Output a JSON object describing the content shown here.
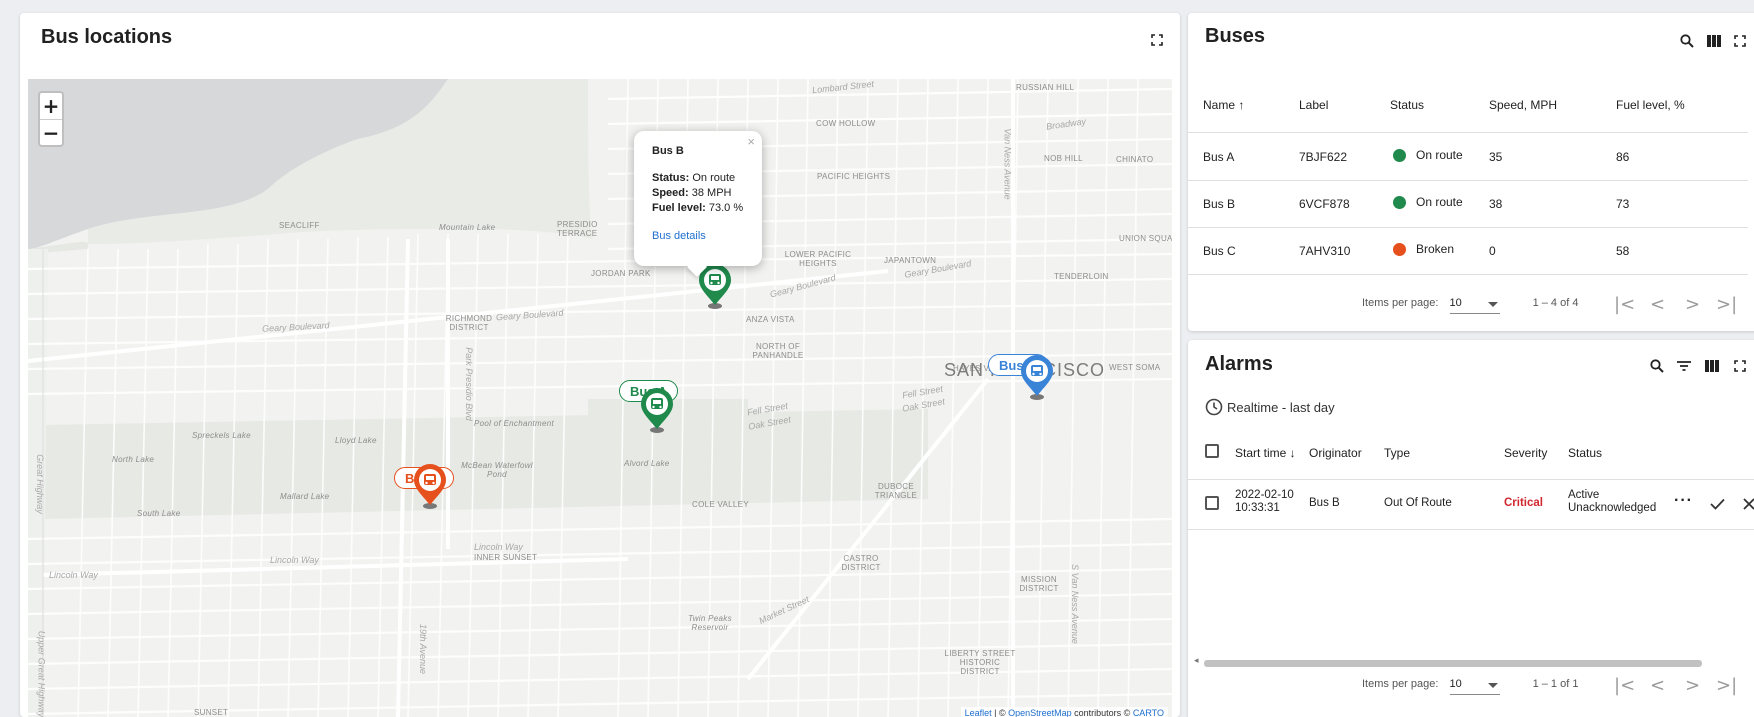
{
  "map_panel": {
    "title": "Bus locations",
    "zoom_in": "+",
    "zoom_out": "−",
    "attribution": {
      "leaflet": "Leaflet",
      "sep1": " | © ",
      "osm": "OpenStreetMap",
      "mid": " contributors © ",
      "carto": "CARTO"
    },
    "area_labels": [
      "RUSSIAN HILL",
      "COW HOLLOW",
      "NOB HILL",
      "CHINATO",
      "PACIFIC HEIGHTS",
      "SEACLIFF",
      "Mountain Lake",
      "PRESIDIO TERRACE",
      "JORDAN PARK",
      "LOWER PACIFIC HEIGHTS",
      "JAPANTOWN",
      "TENDERLOIN",
      "UNION SQUA",
      "RICHMOND DISTRICT",
      "ANZA VISTA",
      "NORTH OF PANHANDLE",
      "HAYES VALL",
      "WEST SOMA",
      "Pool of Enchantment",
      "McBean Waterfowl Pond",
      "Alvord Lake",
      "North Lake",
      "Mallard Lake",
      "South Lake",
      "COLE VALLEY",
      "DUBOCE TRIANGLE",
      "INNER SUNSET",
      "CASTRO DISTRICT",
      "MISSION DISTRICT",
      "LIBERTY STREET HISTORIC DISTRICT",
      "Twin Peaks Reservoir",
      "SUNSET",
      "Spreckels Lake",
      "Lloyd Lake"
    ],
    "street_labels": [
      "Lombard Street",
      "Broadway",
      "Geary Boulevard",
      "Geary Boulevard",
      "Geary Boulevard",
      "Geary Boulevard",
      "Fell Street",
      "Oak Street",
      "Fell Street",
      "Oak Street",
      "Lincoln Way",
      "Lincoln Way",
      "Lincoln Way",
      "Market Street",
      "Van Ness Avenue",
      "Park Presidio Blvd",
      "19th Avenue",
      "Great Highway",
      "Upper Great Highway",
      "S Van Ness Avenue"
    ],
    "city_label": "SAN FRANCISCO",
    "buses": [
      {
        "name": "Bus A",
        "color": "#1f8a4c"
      },
      {
        "name": "Bus B",
        "color": "#1f8a4c"
      },
      {
        "name": "Bus C",
        "color": "#e5501d"
      },
      {
        "name": "Bus D",
        "color": "#3a84d8"
      }
    ],
    "popup": {
      "title": "Bus B",
      "status_label": "Status:",
      "status_value": "On route",
      "speed_label": "Speed:",
      "speed_value": "38 MPH",
      "fuel_label": "Fuel level:",
      "fuel_value": "73.0 %",
      "link": "Bus details",
      "close": "×"
    }
  },
  "buses_panel": {
    "title": "Buses",
    "columns": [
      "Name ↑",
      "Label",
      "Status",
      "Speed, MPH",
      "Fuel level, %"
    ],
    "rows": [
      {
        "name": "Bus A",
        "label": "7BJF622",
        "status": "On route",
        "status_color": "#1f8a4c",
        "speed": "35",
        "fuel": "86"
      },
      {
        "name": "Bus B",
        "label": "6VCF878",
        "status": "On route",
        "status_color": "#1f8a4c",
        "speed": "38",
        "fuel": "73"
      },
      {
        "name": "Bus C",
        "label": "7AHV310",
        "status": "Broken",
        "status_color": "#e5501d",
        "speed": "0",
        "fuel": "58"
      }
    ],
    "pager": {
      "items_label": "Items per page:",
      "page_size": "10",
      "range": "1 – 4 of 4"
    }
  },
  "alarms_panel": {
    "title": "Alarms",
    "timewindow": "Realtime - last day",
    "columns": [
      "Start time ↓",
      "Originator",
      "Type",
      "Severity",
      "Status"
    ],
    "rows": [
      {
        "start_date": "2022-02-10",
        "start_time": "10:33:31",
        "originator": "Bus B",
        "type": "Out Of Route",
        "severity": "Critical",
        "status_line1": "Active",
        "status_line2": "Unacknowledged"
      }
    ],
    "pager": {
      "items_label": "Items per page:",
      "page_size": "10",
      "range": "1 – 1 of 1"
    }
  }
}
